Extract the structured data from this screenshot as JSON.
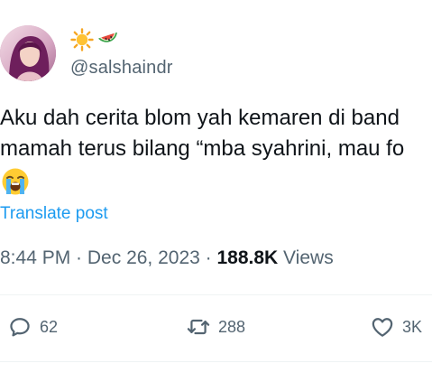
{
  "author": {
    "display_emojis": [
      "sun-emoji",
      "watermelon-emoji"
    ],
    "handle": "@salshaindr"
  },
  "tweet": {
    "lines": [
      "Aku dah cerita blom yah kemaren di band",
      "mamah terus bilang “mba syahrini, mau fo"
    ],
    "emoji": "loudly-crying-face-emoji"
  },
  "translate_label": "Translate post",
  "meta": {
    "time": "8:44 PM",
    "sep1": " · ",
    "date": "Dec 26, 2023",
    "sep2": " · ",
    "views_count": "188.8K",
    "views_label": " Views"
  },
  "actions": {
    "replies": "62",
    "reposts": "288",
    "likes": "3K"
  },
  "colors": {
    "text": "#0f1419",
    "secondary": "#536471",
    "link": "#1d9bf0",
    "divider": "#eff3f4"
  }
}
